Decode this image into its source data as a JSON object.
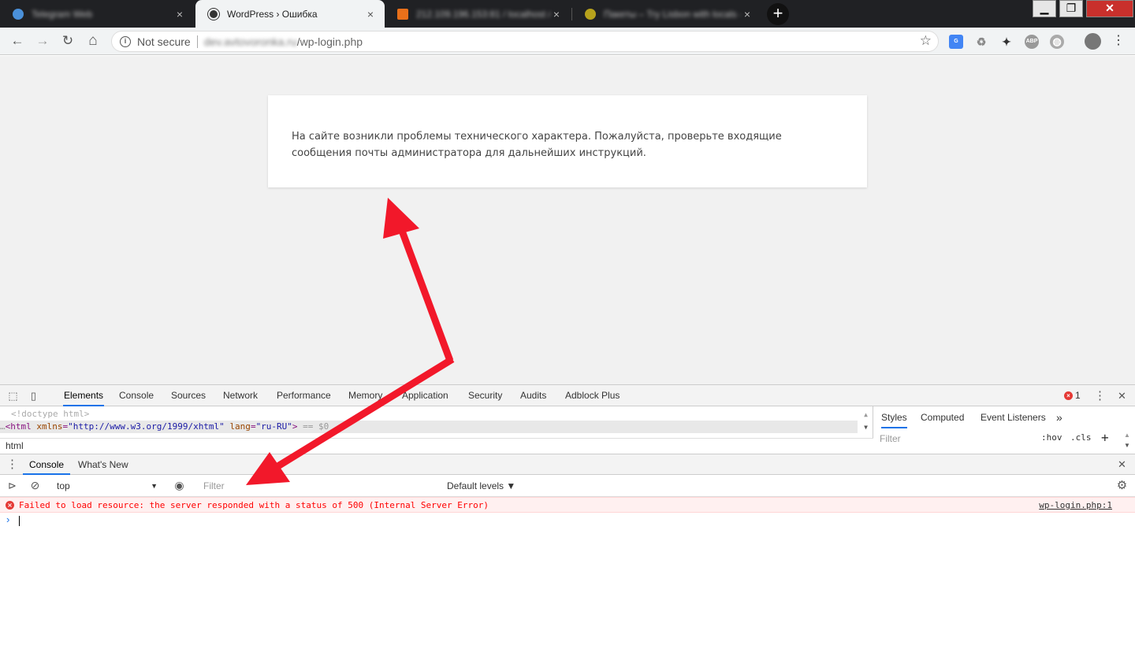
{
  "browser": {
    "tabs": [
      {
        "title": "Telegram Web",
        "active": false,
        "favicon_color": "#4a90d9"
      },
      {
        "title": "WordPress › Ошибка",
        "active": true,
        "favicon_color": "#333333"
      },
      {
        "title": "212.109.196.153:81 / localhost / с",
        "active": false,
        "favicon_color": "#e8701a"
      },
      {
        "title": "Пакеты – Try Lisbon with locals –",
        "active": false,
        "favicon_color": "#b7a21c"
      }
    ],
    "close_glyph": "×",
    "new_tab_glyph": "+",
    "window_controls": {
      "minimize": "▁",
      "maximize": "❐",
      "close": "✕"
    },
    "nav": {
      "back": "←",
      "forward": "→",
      "reload": "↻",
      "home": "⌂"
    },
    "address": {
      "security": "Not secure",
      "host": "dev.avtovoronka.ru",
      "path": "/wp-login.php",
      "star": "☆"
    },
    "extensions": [
      "G",
      "♻",
      "✦",
      "ABP",
      "◍"
    ],
    "menu": "⋮"
  },
  "page": {
    "message": "На сайте возникли проблемы технического характера. Пожалуйста, проверьте входящие сообщения почты администратора для дальнейших инструкций."
  },
  "devtools": {
    "tabs": [
      "Elements",
      "Console",
      "Sources",
      "Network",
      "Performance",
      "Memory",
      "Application",
      "Security",
      "Audits",
      "Adblock Plus"
    ],
    "error_count": "1",
    "more": "⋮",
    "close": "✕",
    "elements": {
      "doctype": "<!doctype html>",
      "html_line": {
        "prefix": "…",
        "open": "<html",
        "attr1": "xmlns",
        "eq": "=",
        "val1": "\"http://www.w3.org/1999/xhtml\"",
        "attr2": "lang",
        "val2": "\"ru-RU\"",
        "close": ">",
        "suffix": "== $0"
      },
      "breadcrumb": "html"
    },
    "styles": {
      "tabs": [
        "Styles",
        "Computed",
        "Event Listeners"
      ],
      "more": "»",
      "filter_placeholder": "Filter",
      "hov": ":hov",
      "cls": ".cls",
      "add": "+"
    },
    "drawer": {
      "menu": "⋮",
      "tabs": [
        "Console",
        "What's New"
      ],
      "close": "✕"
    },
    "console": {
      "context": "top",
      "context_arrow": "▼",
      "filter_placeholder": "Filter",
      "levels": "Default levels ▼",
      "error_message": "Failed to load resource: the server responded with a status of 500 (Internal Server Error)",
      "error_source": "wp-login.php:1",
      "prompt": "›"
    }
  }
}
